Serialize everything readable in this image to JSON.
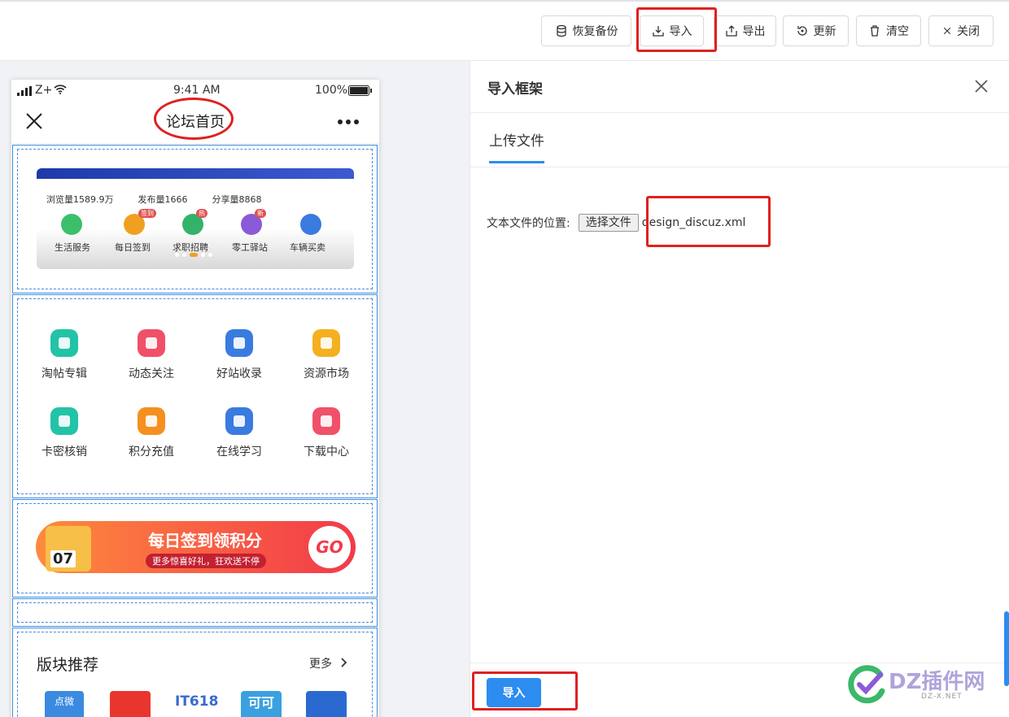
{
  "toolbar": {
    "restore": "恢复备份",
    "import": "导入",
    "export": "导出",
    "update": "更新",
    "clear": "清空",
    "close": "关闭"
  },
  "phone": {
    "status": {
      "carrier": "Z+",
      "time": "9:41 AM",
      "battery": "100%"
    },
    "title": "论坛首页",
    "banner": {
      "stats": [
        "浏览量1589.9万",
        "发布量1666",
        "分享量8868"
      ],
      "items": [
        "生活服务",
        "每日签到",
        "求职招聘",
        "零工驿站",
        "车辆买卖"
      ],
      "badges": [
        "签到",
        "热",
        "新"
      ]
    },
    "grid": [
      "淘帖专辑",
      "动态关注",
      "好站收录",
      "资源市场",
      "卡密核销",
      "积分充值",
      "在线学习",
      "下载中心"
    ],
    "signin": {
      "title": "每日签到领积分",
      "subtitle": "更多惊喜好礼，狂欢送不停",
      "go": "GO",
      "date": "07"
    },
    "section": {
      "title": "版块推荐",
      "more": "更多"
    },
    "thumbs": [
      "点微",
      "",
      "IT618",
      "可可",
      ""
    ]
  },
  "panel": {
    "title": "导入框架",
    "tab": "上传文件",
    "file_label": "文本文件的位置:",
    "file_button": "选择文件",
    "file_name": "design_discuz.xml",
    "submit": "导入"
  },
  "watermark": {
    "brand": "DZ插件网",
    "url": "DZ-X.NET"
  },
  "colors": {
    "accent": "#2d8cf0",
    "highlight": "#e02020"
  }
}
